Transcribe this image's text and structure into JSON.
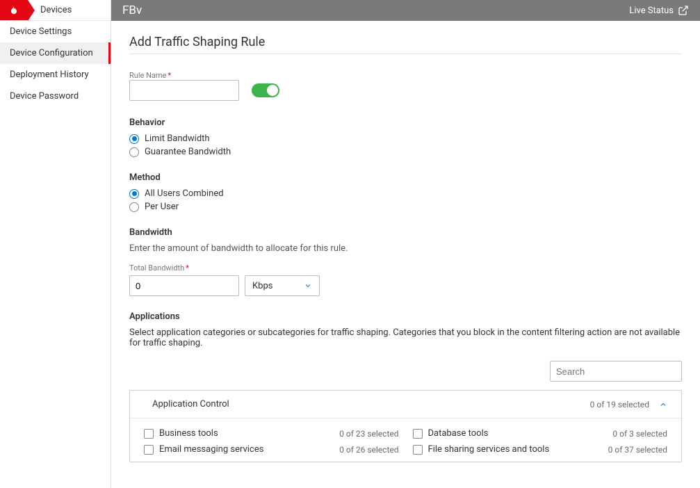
{
  "breadcrumb": "Devices",
  "nav": [
    "Device Settings",
    "Device Configuration",
    "Deployment History",
    "Device Password"
  ],
  "nav_active_index": 1,
  "topbar": {
    "title": "FBv",
    "live": "Live Status"
  },
  "page_title": "Add Traffic Shaping Rule",
  "rule_name_label": "Rule Name",
  "behavior": {
    "heading": "Behavior",
    "limit": "Limit Bandwidth",
    "guarantee": "Guarantee Bandwidth"
  },
  "method": {
    "heading": "Method",
    "all": "All Users Combined",
    "per": "Per User"
  },
  "bandwidth": {
    "heading": "Bandwidth",
    "hint": "Enter the amount of bandwidth to allocate for this rule.",
    "total_label": "Total Bandwidth",
    "value": "0",
    "unit": "Kbps"
  },
  "applications": {
    "heading": "Applications",
    "hint": "Select application categories or subcategories for traffic shaping. Categories that you block in the content filtering action are not available for traffic shaping.",
    "search_placeholder": "Search",
    "panel_title": "Application Control",
    "panel_summary": "0 of 19 selected",
    "categories": [
      {
        "label": "Business tools",
        "count": "0 of 23 selected"
      },
      {
        "label": "Database tools",
        "count": "0 of 3 selected"
      },
      {
        "label": "Email messaging services",
        "count": "0 of 26 selected"
      },
      {
        "label": "File sharing services and tools",
        "count": "0 of 37 selected"
      }
    ]
  }
}
